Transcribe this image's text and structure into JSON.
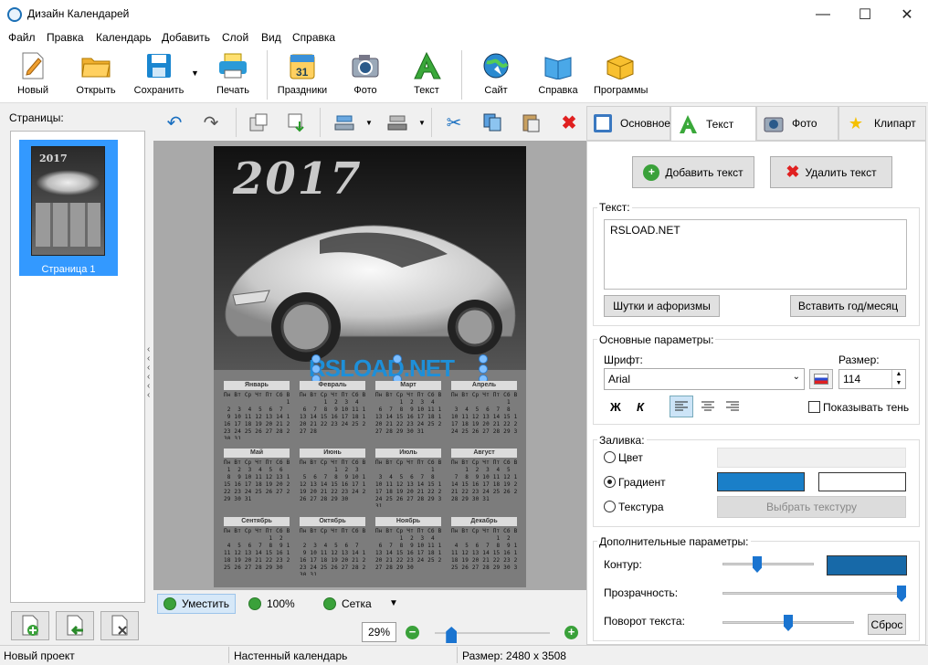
{
  "window": {
    "title": "Дизайн Календарей",
    "minimize": "—",
    "maximize": "☐",
    "close": "✕"
  },
  "menu": [
    "Файл",
    "Правка",
    "Календарь",
    "Добавить",
    "Слой",
    "Вид",
    "Справка"
  ],
  "toolbar": {
    "new": "Новый",
    "open": "Открыть",
    "save": "Сохранить",
    "print": "Печать",
    "holidays": "Праздники",
    "photo": "Фото",
    "text": "Текст",
    "site": "Сайт",
    "help": "Справка",
    "programs": "Программы",
    "holidays_icon_number": "31"
  },
  "left_panel": {
    "pages_label": "Страницы:",
    "page_name": "Страница 1",
    "thumb_year": "2017"
  },
  "canvas": {
    "year": "2017",
    "overlay_text": "RSLOAD.NET",
    "months": [
      {
        "name": "Январь",
        "days": "Пн Вт Ср Чт Пт Сб Вс\n                  1\n 2  3  4  5  6  7  8\n 9 10 11 12 13 14 15\n16 17 18 19 20 21 22\n23 24 25 26 27 28 29\n30 31"
      },
      {
        "name": "Февраль",
        "days": "Пн Вт Ср Чт Пт Сб Вс\n       1  2  3  4  5\n 6  7  8  9 10 11 12\n13 14 15 16 17 18 19\n20 21 22 23 24 25 26\n27 28"
      },
      {
        "name": "Март",
        "days": "Пн Вт Ср Чт Пт Сб Вс\n       1  2  3  4  5\n 6  7  8  9 10 11 12\n13 14 15 16 17 18 19\n20 21 22 23 24 25 26\n27 28 29 30 31"
      },
      {
        "name": "Апрель",
        "days": "Пн Вт Ср Чт Пт Сб Вс\n                1  2\n 3  4  5  6  7  8  9\n10 11 12 13 14 15 16\n17 18 19 20 21 22 23\n24 25 26 27 28 29 30"
      },
      {
        "name": "Май",
        "days": "Пн Вт Ср Чт Пт Сб Вс\n 1  2  3  4  5  6  7\n 8  9 10 11 12 13 14\n15 16 17 18 19 20 21\n22 23 24 25 26 27 28\n29 30 31"
      },
      {
        "name": "Июнь",
        "days": "Пн Вт Ср Чт Пт Сб Вс\n          1  2  3  4\n 5  6  7  8  9 10 11\n12 13 14 15 16 17 18\n19 20 21 22 23 24 25\n26 27 28 29 30"
      },
      {
        "name": "Июль",
        "days": "Пн Вт Ср Чт Пт Сб Вс\n                1  2\n 3  4  5  6  7  8  9\n10 11 12 13 14 15 16\n17 18 19 20 21 22 23\n24 25 26 27 28 29 30\n31"
      },
      {
        "name": "Август",
        "days": "Пн Вт Ср Чт Пт Сб Вс\n    1  2  3  4  5  6\n 7  8  9 10 11 12 13\n14 15 16 17 18 19 20\n21 22 23 24 25 26 27\n28 29 30 31"
      },
      {
        "name": "Сентябрь",
        "days": "Пн Вт Ср Чт Пт Сб Вс\n             1  2  3\n 4  5  6  7  8  9 10\n11 12 13 14 15 16 17\n18 19 20 21 22 23 24\n25 26 27 28 29 30"
      },
      {
        "name": "Октябрь",
        "days": "Пн Вт Ср Чт Пт Сб Вс\n                   1\n 2  3  4  5  6  7  8\n 9 10 11 12 13 14 15\n16 17 18 19 20 21 22\n23 24 25 26 27 28 29\n30 31"
      },
      {
        "name": "Ноябрь",
        "days": "Пн Вт Ср Чт Пт Сб Вс\n       1  2  3  4  5\n 6  7  8  9 10 11 12\n13 14 15 16 17 18 19\n20 21 22 23 24 25 26\n27 28 29 30"
      },
      {
        "name": "Декабрь",
        "days": "Пн Вт Ср Чт Пт Сб Вс\n             1  2  3\n 4  5  6  7  8  9 10\n11 12 13 14 15 16 17\n18 19 20 21 22 23 24\n25 26 27 28 29 30 31"
      }
    ]
  },
  "bottom": {
    "fit": "Уместить",
    "zoom100": "100%",
    "grid": "Сетка",
    "zoom_value": "29%",
    "zoom_slider_percent": 29
  },
  "tabs": {
    "basic": "Основное",
    "text": "Текст",
    "photo": "Фото",
    "clipart": "Клипарт"
  },
  "text_panel": {
    "add_text": "Добавить текст",
    "delete_text": "Удалить текст",
    "text_label": "Текст:",
    "text_value": "RSLOAD.NET",
    "jokes_button": "Шутки и афоризмы",
    "insert_year_button": "Вставить год/месяц",
    "basic_params": "Основные параметры:",
    "font_label": "Шрифт:",
    "font_value": "Arial",
    "size_label": "Размер:",
    "size_value": "114",
    "bold": "Ж",
    "italic": "К",
    "show_shadow": "Показывать тень",
    "fill_label": "Заливка:",
    "fill_color": "Цвет",
    "fill_gradient": "Градиент",
    "fill_texture": "Текстура",
    "choose_texture": "Выбрать текстуру",
    "gradient_color_1": "#1a7fc8",
    "gradient_color_2": "#ffffff",
    "extra_params": "Дополнительные параметры:",
    "outline_label": "Контур:",
    "outline_color": "#1769a8",
    "outline_slider_percent": 38,
    "transparency_label": "Прозрачность:",
    "transparency_slider_percent": 100,
    "rotate_label": "Поворот текста:",
    "rotate_slider_percent": 50,
    "reset": "Сброс"
  },
  "status": {
    "project": "Новый проект",
    "type": "Настенный календарь",
    "size": "Размер: 2480 x 3508"
  }
}
